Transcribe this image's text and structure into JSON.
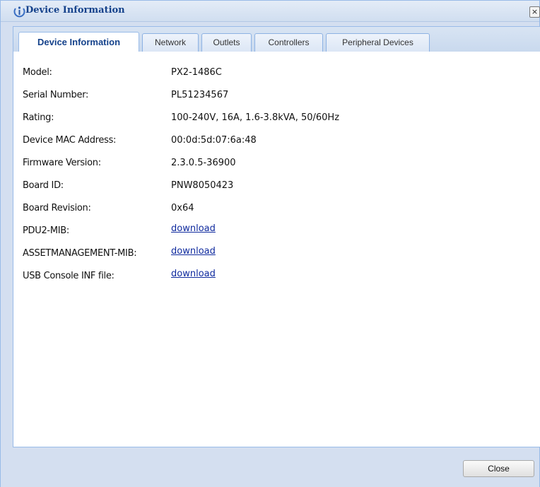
{
  "window": {
    "title": "Device Information",
    "title_icon": "info-icon",
    "close_icon": "close-icon",
    "close_glyph": "×"
  },
  "tabs": [
    {
      "label": "Device Information",
      "active": true
    },
    {
      "label": "Network",
      "active": false
    },
    {
      "label": "Outlets",
      "active": false
    },
    {
      "label": "Controllers",
      "active": false
    },
    {
      "label": "Peripheral Devices",
      "active": false
    }
  ],
  "info": [
    {
      "label": "Model:",
      "value": "PX2-1486C"
    },
    {
      "label": "Serial Number:",
      "value": "PL51234567"
    },
    {
      "label": "Rating:",
      "value": "100-240V, 16A, 1.6-3.8kVA, 50/60Hz"
    },
    {
      "label": "Device MAC Address:",
      "value": "00:0d:5d:07:6a:48"
    },
    {
      "label": "Firmware Version:",
      "value": "2.3.0.5-36900"
    },
    {
      "label": "Board ID:",
      "value": "PNW8050423"
    },
    {
      "label": "Board Revision:",
      "value": "0x64"
    },
    {
      "label": "PDU2-MIB:",
      "value": "download"
    },
    {
      "label": "ASSETMANAGEMENT-MIB:",
      "value": "download"
    },
    {
      "label": "USB Console INF file:",
      "value": "download"
    }
  ],
  "footer": {
    "close_label": "Close"
  },
  "colors": {
    "title_text": "#15428b",
    "panel_background": "#d4dff0",
    "border": "#99bbe8",
    "link": "#0f2a9e"
  }
}
